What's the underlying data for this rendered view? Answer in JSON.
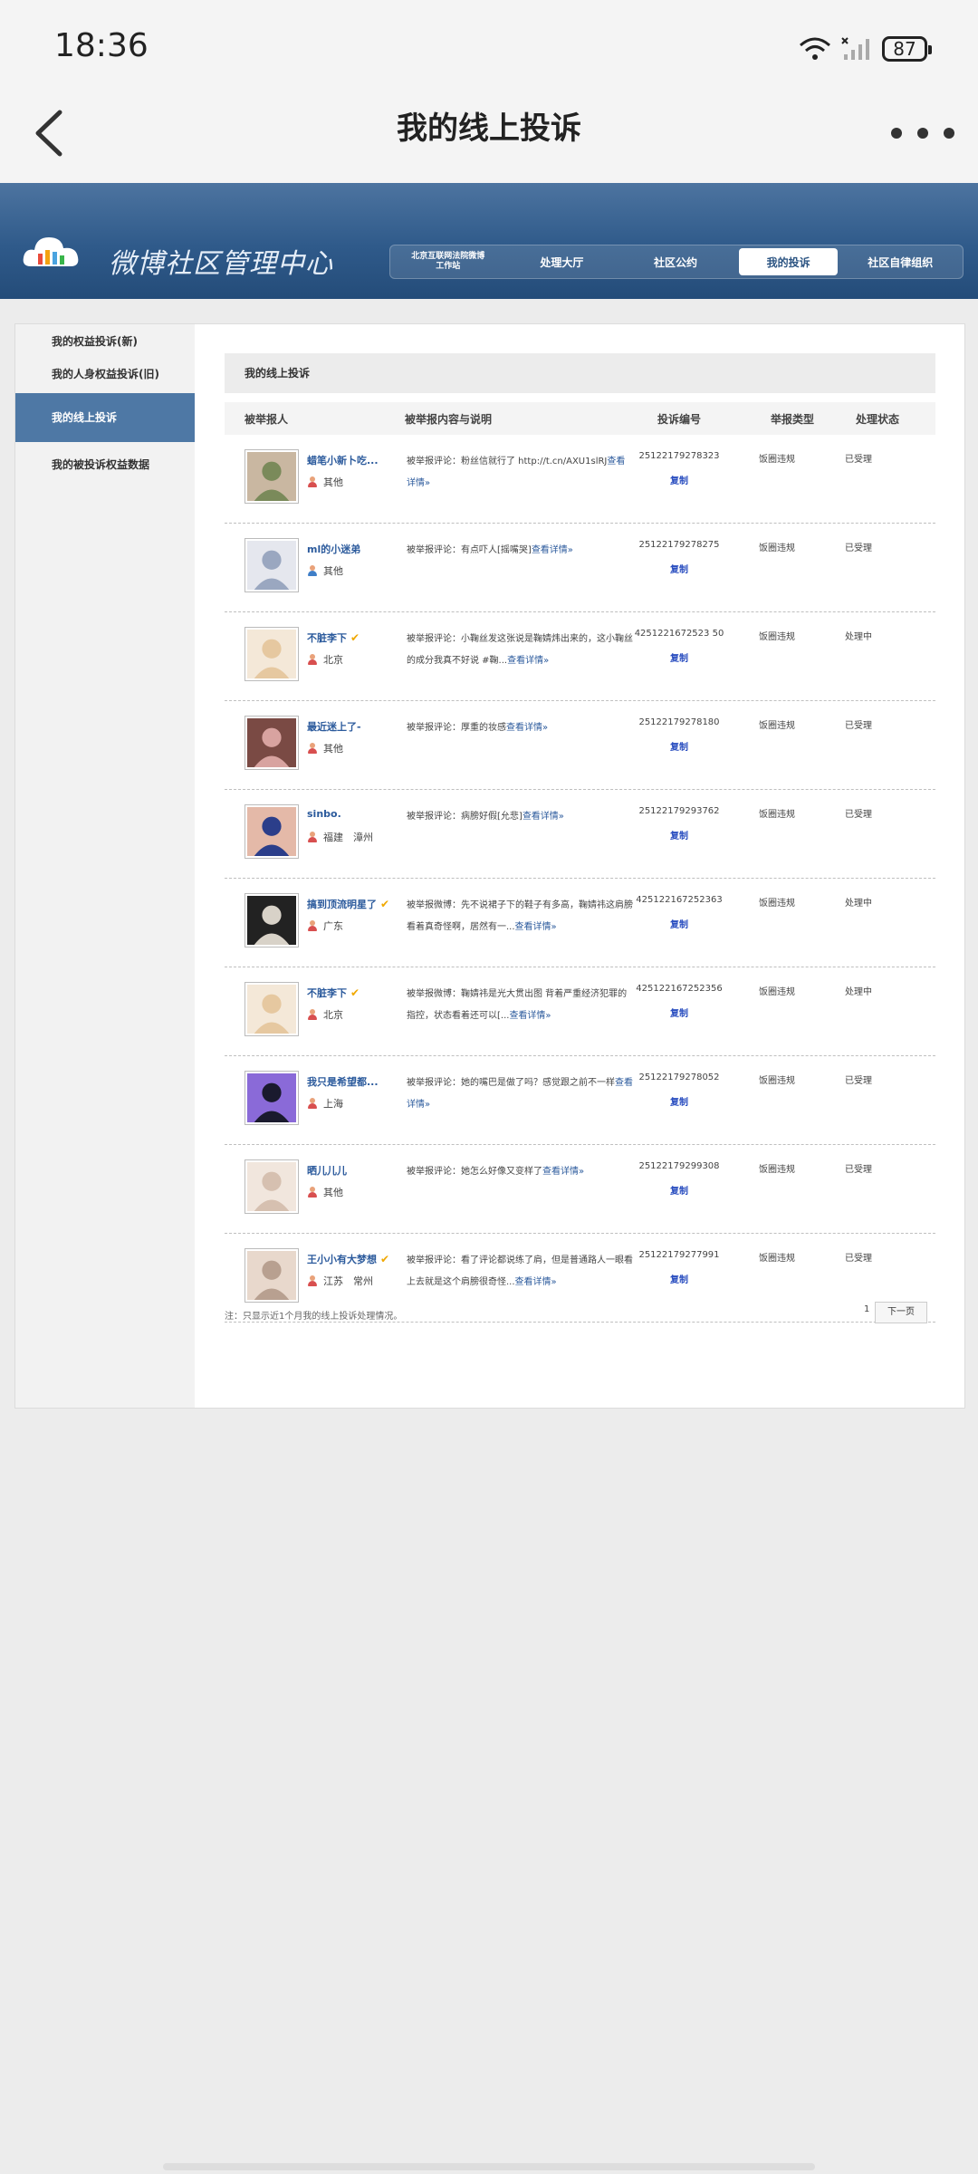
{
  "status_bar": {
    "time": "18:36",
    "battery": "87"
  },
  "nav": {
    "title": "我的线上投诉",
    "back_icon": "back-chevron-icon",
    "more_icon": "more-dots-icon"
  },
  "header": {
    "brand": "微博社区管理中心",
    "tabs": [
      {
        "label": "北京互联网法院微博\n工作站"
      },
      {
        "label": "处理大厅"
      },
      {
        "label": "社区公约"
      },
      {
        "label": "我的投诉"
      },
      {
        "label": "社区自律组织"
      }
    ]
  },
  "sidebar": {
    "items": [
      {
        "label": "我的权益投诉(新)"
      },
      {
        "label": "我的人身权益投诉(旧)"
      },
      {
        "label": "我的线上投诉"
      },
      {
        "label": "我的被投诉权益数据"
      }
    ]
  },
  "main": {
    "section_title": "我的线上投诉",
    "columns": [
      "被举报人",
      "被举报内容与说明",
      "投诉编号",
      "举报类型",
      "处理状态"
    ],
    "copy_label": "复制",
    "detail_link": "查看详情»",
    "rows": [
      {
        "user": "蜡笔小新卜吃...",
        "location": "其他",
        "content_a": "被举报评论：粉丝信就行了 http://t.cn/AXU1slRJ",
        "content_b": "查看详情»",
        "id": "25122179278323",
        "type": "饭圈违规",
        "status": "已受理"
      },
      {
        "user": "ml的小迷弟",
        "location": "其他",
        "content_a": "被举报评论：有点吓人[摇嘴哭]",
        "content_b": "查看详情»",
        "id": "25122179278275",
        "type": "饭圈违规",
        "status": "已受理"
      },
      {
        "user": "不脏李下",
        "location": "北京",
        "content_a": "被举报评论：小鞠丝发这张说是鞠婧炜出来的，这小鞠丝的成分我真不好说 #鞠...",
        "content_b": "查看详情»",
        "id": "4251221672523 50",
        "type": "饭圈违规",
        "status": "处理中"
      },
      {
        "user": "最近迷上了-",
        "location": "其他",
        "content_a": "被举报评论：厚重的妆感",
        "content_b": "查看详情»",
        "id": "25122179278180",
        "type": "饭圈违规",
        "status": "已受理"
      },
      {
        "user": "sinbo.",
        "location": "福建　漳州",
        "content_a": "被举报评论：病膀好假[允悲]",
        "content_b": "查看详情»",
        "id": "25122179293762",
        "type": "饭圈违规",
        "status": "已受理"
      },
      {
        "user": "搞到顶流明星了",
        "location": "广东",
        "content_a": "被举报微博：先不说裙子下的鞋子有多高，鞠婧祎这肩膀看着真奇怪啊，居然有一...",
        "content_b": "查看详情»",
        "id": "425122167252363",
        "type": "饭圈违规",
        "status": "处理中"
      },
      {
        "user": "不脏李下",
        "location": "北京",
        "content_a": "被举报微博：鞠婧祎是光大贯出图 背着严重经济犯罪的指控，状态看着还可以[...",
        "content_b": "查看详情»",
        "id": "425122167252356",
        "type": "饭圈违规",
        "status": "处理中"
      },
      {
        "user": "我只是希望都...",
        "location": "上海",
        "content_a": "被举报评论：她的嘴巴是做了吗？感觉跟之前不一样",
        "content_b": "查看详情»",
        "id": "25122179278052",
        "type": "饭圈违规",
        "status": "已受理"
      },
      {
        "user": "晒儿儿儿",
        "location": "其他",
        "content_a": "被举报评论：她怎么好像又变样了",
        "content_b": "查看详情»",
        "id": "25122179299308",
        "type": "饭圈违规",
        "status": "已受理"
      },
      {
        "user": "王小小有大梦想",
        "location": "江苏　常州",
        "content_a": "被举报评论：看了评论都说练了肩，但是普通路人一眼看上去就是这个肩膀很奇怪...",
        "content_b": "查看详情»",
        "id": "25122179277991",
        "type": "饭圈违规",
        "status": "已受理"
      }
    ],
    "note": "注：只显示近1个月我的线上投诉处理情况。",
    "pager": {
      "current": "1",
      "next": "下一页"
    }
  }
}
